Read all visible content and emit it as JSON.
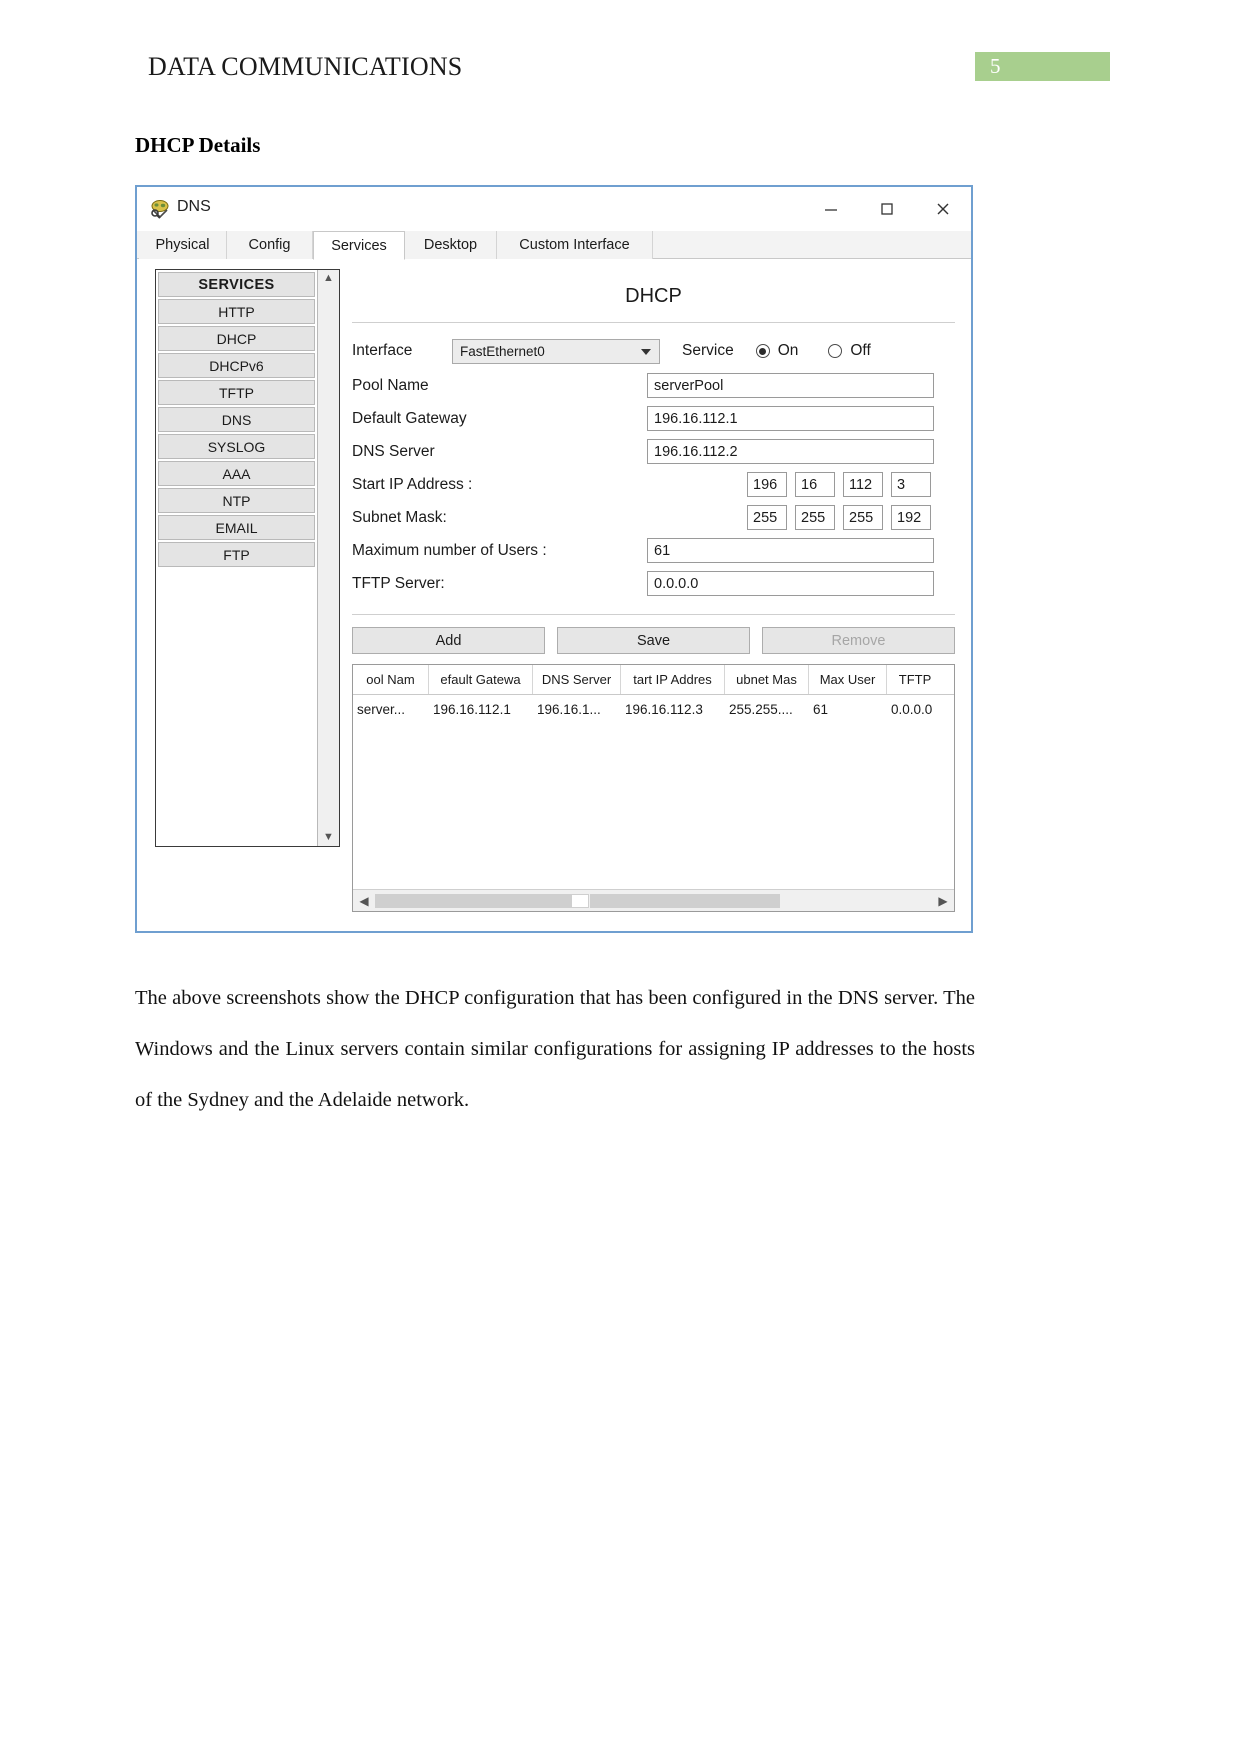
{
  "document": {
    "header_title": "DATA COMMUNICATIONS",
    "page_number": "5",
    "badge_color": "#a8cf8e",
    "section_heading": "DHCP Details",
    "paragraph": "The above screenshots show the DHCP configuration that has been configured in the DNS server. The Windows and the Linux servers contain similar configurations for assigning IP addresses to the hosts of the Sydney and the Adelaide network."
  },
  "window": {
    "title": "DNS",
    "icon": "server-icon",
    "controls": {
      "minimize": "minimize-icon",
      "maximize": "maximize-icon",
      "close": "close-icon"
    },
    "tabs": [
      {
        "label": "Physical",
        "active": false
      },
      {
        "label": "Config",
        "active": false
      },
      {
        "label": "Services",
        "active": true
      },
      {
        "label": "Desktop",
        "active": false
      },
      {
        "label": "Custom Interface",
        "active": false
      }
    ],
    "sidebar": {
      "header": "SERVICES",
      "items": [
        {
          "label": "HTTP"
        },
        {
          "label": "DHCP"
        },
        {
          "label": "DHCPv6"
        },
        {
          "label": "TFTP"
        },
        {
          "label": "DNS"
        },
        {
          "label": "SYSLOG"
        },
        {
          "label": "AAA"
        },
        {
          "label": "NTP"
        },
        {
          "label": "EMAIL"
        },
        {
          "label": "FTP"
        }
      ],
      "scroll_up": "chevron-up-icon",
      "scroll_down": "chevron-down-icon"
    },
    "panel": {
      "title": "DHCP",
      "interface_label": "Interface",
      "interface_value": "FastEthernet0",
      "service_label": "Service",
      "service_on_label": "On",
      "service_off_label": "Off",
      "service_selected": "On",
      "fields": [
        {
          "label": "Pool Name",
          "value": "serverPool"
        },
        {
          "label": "Default Gateway",
          "value": "196.16.112.1"
        },
        {
          "label": "DNS Server",
          "value": "196.16.112.2"
        }
      ],
      "start_ip_label": "Start IP Address :",
      "start_ip_octets": [
        "196",
        "16",
        "112",
        "3"
      ],
      "subnet_mask_label": "Subnet Mask:",
      "subnet_mask_octets": [
        "255",
        "255",
        "255",
        "192"
      ],
      "max_users_label": "Maximum number of Users :",
      "max_users_value": "61",
      "tftp_label": "TFTP Server:",
      "tftp_value": "0.0.0.0",
      "buttons": [
        {
          "label": "Add",
          "disabled": false
        },
        {
          "label": "Save",
          "disabled": false
        },
        {
          "label": "Remove",
          "disabled": true
        }
      ],
      "table": {
        "columns": [
          "ool Nam",
          "efault Gatewa",
          "DNS Server",
          "tart IP Addres",
          "ubnet Mas",
          "Max User",
          "TFTP"
        ],
        "rows": [
          [
            "server...",
            "196.16.112.1",
            "196.16.1...",
            "196.16.112.3",
            "255.255....",
            "61",
            "0.0.0.0"
          ]
        ],
        "scroll_left": "arrow-left-icon",
        "scroll_right": "arrow-right-icon"
      }
    }
  }
}
